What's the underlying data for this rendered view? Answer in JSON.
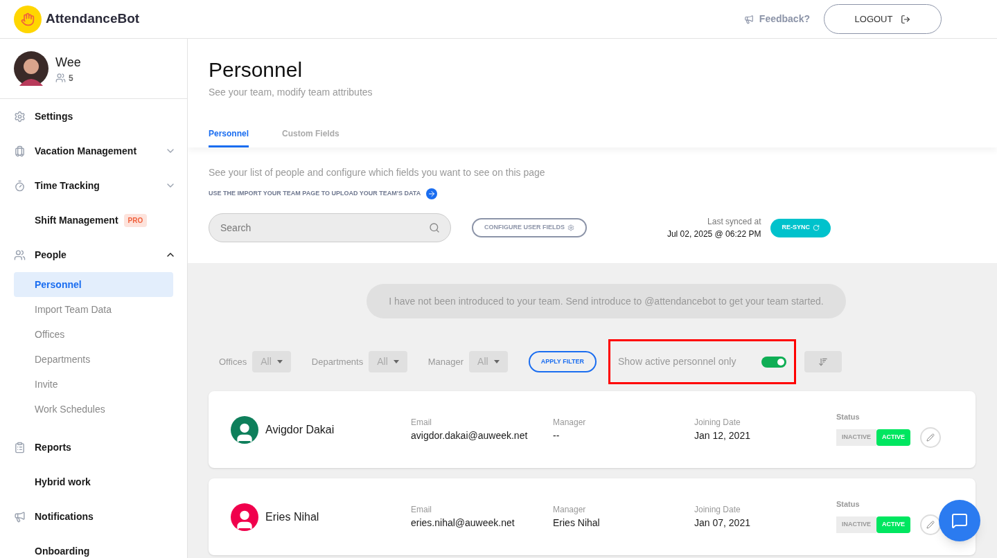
{
  "header": {
    "brand": "AttendanceBot",
    "feedback": "Feedback?",
    "logout": "LOGOUT"
  },
  "profile": {
    "name": "Wee",
    "team_count": "5"
  },
  "sidebar": {
    "items": [
      {
        "label": "Settings"
      },
      {
        "label": "Vacation Management",
        "expanded": false
      },
      {
        "label": "Time Tracking",
        "expanded": false
      },
      {
        "label": "Shift Management",
        "badge": "PRO"
      },
      {
        "label": "People",
        "expanded": true,
        "children": [
          {
            "label": "Personnel",
            "selected": true
          },
          {
            "label": "Import Team Data",
            "selected": false
          },
          {
            "label": "Offices",
            "selected": false
          },
          {
            "label": "Departments",
            "selected": false
          },
          {
            "label": "Invite",
            "selected": false
          },
          {
            "label": "Work Schedules",
            "selected": false
          }
        ]
      },
      {
        "label": "Reports"
      },
      {
        "label": "Hybrid work"
      },
      {
        "label": "Notifications"
      },
      {
        "label": "Onboarding"
      }
    ]
  },
  "page": {
    "title": "Personnel",
    "subtitle": "See your team, modify team attributes",
    "tabs": [
      {
        "label": "Personnel",
        "selected": true
      },
      {
        "label": "Custom Fields",
        "selected": false
      }
    ],
    "description": "See your list of people and configure which fields you want to see on this page",
    "import_link": "USE THE IMPORT YOUR TEAM PAGE TO UPLOAD YOUR TEAM'S DATA",
    "search": {
      "placeholder": "Search"
    },
    "configure_button": "CONFIGURE USER FIELDS",
    "last_synced_label": "Last synced at",
    "last_synced": "Jul 02, 2025 @ 06:22 PM",
    "resync_button": "RE-SYNC"
  },
  "notice": "I have not been introduced to your team. Send introduce to @attendancebot to get your team started.",
  "filters": [
    {
      "label": "Offices",
      "value": "All"
    },
    {
      "label": "Departments",
      "value": "All"
    },
    {
      "label": "Manager",
      "value": "All"
    }
  ],
  "apply_filter": "APPLY FILTER",
  "active_toggle": {
    "label": "Show active personnel only",
    "on": true
  },
  "personnel": [
    {
      "name": "Avigdor Dakai",
      "color": "#0e7f5b",
      "email_label": "Email",
      "email": "avigdor.dakai@auweek.net",
      "manager_label": "Manager",
      "manager": "--",
      "joining_label": "Joining Date",
      "joining": "Jan 12, 2021",
      "status_label": "Status",
      "status": [
        {
          "label": "INACTIVE",
          "selected": false
        },
        {
          "label": "ACTIVE",
          "selected": true
        }
      ]
    },
    {
      "name": "Eries Nihal",
      "color": "#f0004c",
      "email_label": "Email",
      "email": "eries.nihal@auweek.net",
      "manager_label": "Manager",
      "manager": "Eries Nihal",
      "joining_label": "Joining Date",
      "joining": "Jan 07, 2021",
      "status_label": "Status",
      "status": [
        {
          "label": "INACTIVE",
          "selected": false
        },
        {
          "label": "ACTIVE",
          "selected": true
        }
      ]
    }
  ]
}
